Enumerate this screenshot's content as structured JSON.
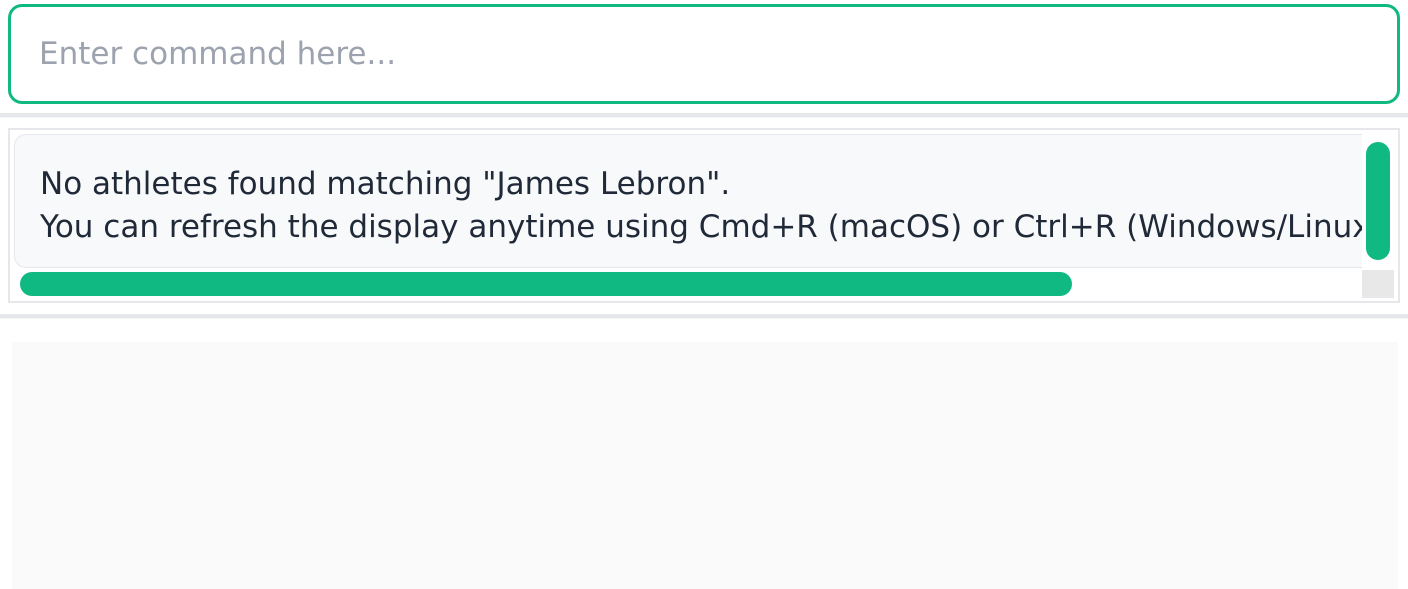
{
  "command": {
    "placeholder": "Enter command here...",
    "value": ""
  },
  "result": {
    "lines": [
      "No athletes found matching \"James Lebron\".",
      "You can refresh the display anytime using Cmd+R (macOS) or Ctrl+R (Windows/Linux) to"
    ]
  },
  "colors": {
    "accent": "#10b981",
    "text": "#1f2937",
    "placeholder": "#9ca3af",
    "result_background": "#f8f9fb",
    "display_background": "#fafafa"
  },
  "scrollbars": {
    "horizontal_thumb_fraction": 0.78,
    "vertical_thumb_fraction": 0.87
  }
}
